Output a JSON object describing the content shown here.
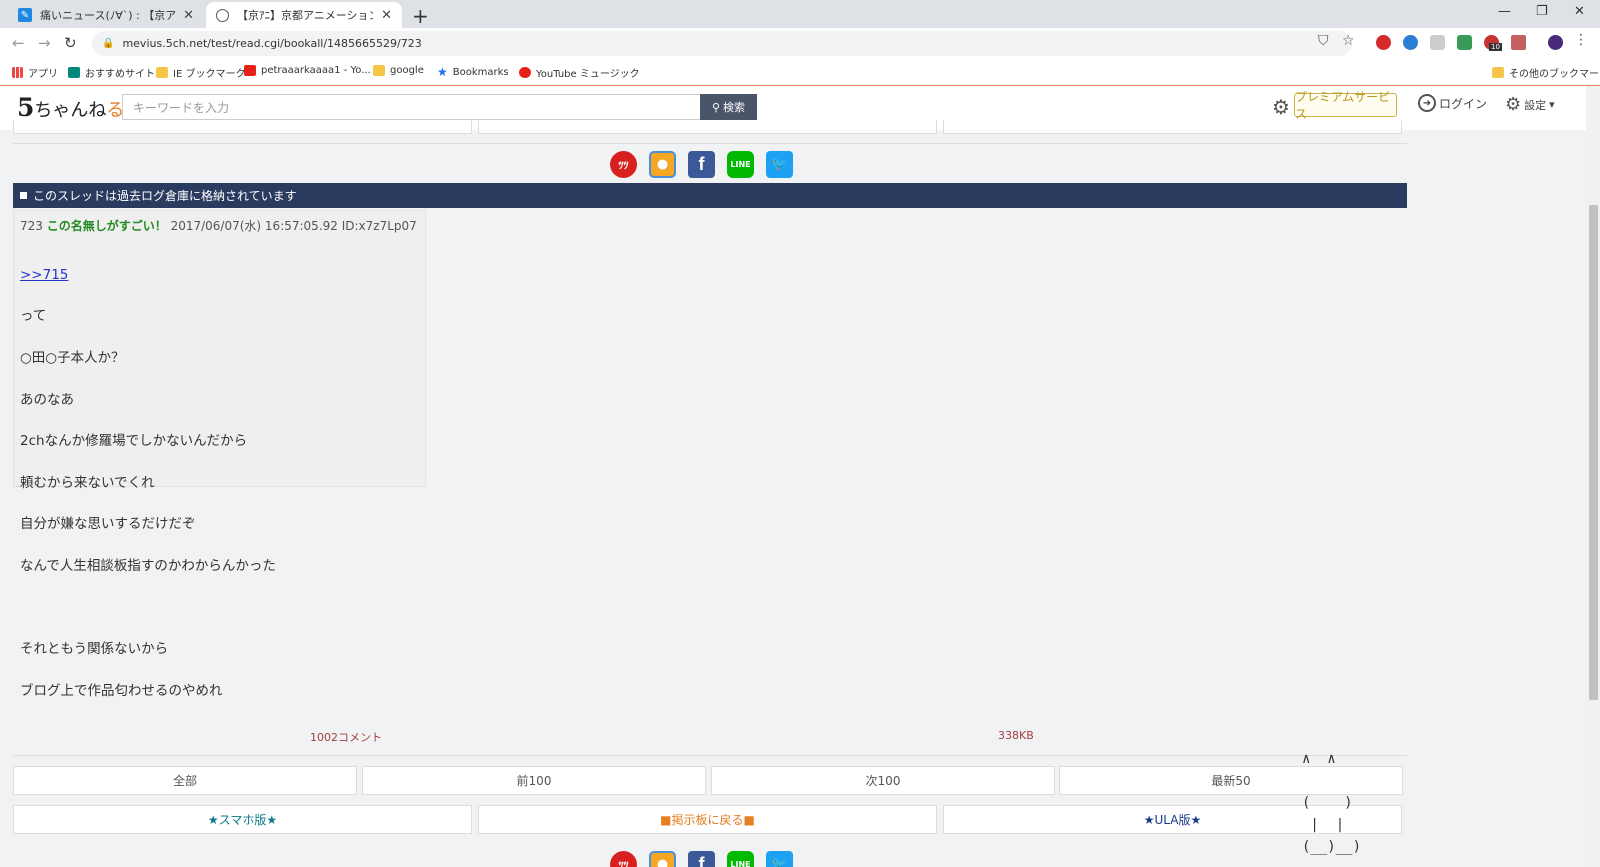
{
  "browser": {
    "tabs": [
      {
        "title": "痛いニュース(ﾉ∀`) : 【京アニ放火】容"
      },
      {
        "title": "【京ｱﾆ】京都アニメーション大賞【KAN"
      }
    ],
    "url": "mevius.5ch.net/test/read.cgi/bookall/1485665529/723",
    "bookmarks": [
      {
        "label": "アプリ"
      },
      {
        "label": "おすすめサイト"
      },
      {
        "label": "IE ブックマーク"
      },
      {
        "label": "petraaarkaaaa1 - Yo..."
      },
      {
        "label": "google"
      },
      {
        "label": "Bookmarks"
      },
      {
        "label": "YouTube ミュージック"
      }
    ],
    "other_bookmarks": "その他のブックマーク",
    "ext_badge": "10"
  },
  "site": {
    "logo_five": "5",
    "logo_text": "ちゃんね",
    "logo_ru": "る",
    "search_placeholder": "キーワードを入力",
    "search_button": "検索",
    "premium": "プレミアムサービス",
    "login": "ログイン",
    "settings": "設定"
  },
  "banner": "このスレッドは過去ログ倉庫に格納されています",
  "post": {
    "number": "723",
    "name": "この名無しがすごい！",
    "date": "2017/06/07(水) 16:57:05.92",
    "id": "ID:x7z7Lp07",
    "anchor": ">>715",
    "lines": [
      "って",
      "○田○子本人か？",
      "あのなあ",
      "2chなんか修羅場でしかないんだから",
      "頼むから来ないでくれ",
      "自分が嫌な思いするだけだぞ",
      "なんで人生相談板指すのかわからんかった",
      "",
      "それともう関係ないから",
      "ブログ上で作品匂わせるのやめれ"
    ]
  },
  "stats": {
    "comments": "1002コメント",
    "size": "338KB"
  },
  "nav": {
    "all": "全部",
    "prev100": "前100",
    "next100": "次100",
    "latest50": "最新50"
  },
  "links": {
    "smartphone": "★スマホ版★",
    "back": "■掲示板に戻る■",
    "ula": "★ULA版★"
  },
  "share_icons": [
    "hatena-icon",
    "pocket-icon",
    "facebook-icon",
    "line-icon",
    "twitter-icon"
  ],
  "colors": {
    "banner_bg": "#2b3a5f",
    "name_green": "#228b22",
    "anchor_blue": "#2233cc",
    "back_orange": "#e67e22",
    "smartphone_teal": "#0a7a8a",
    "ula_navy": "#1a3a8a"
  }
}
